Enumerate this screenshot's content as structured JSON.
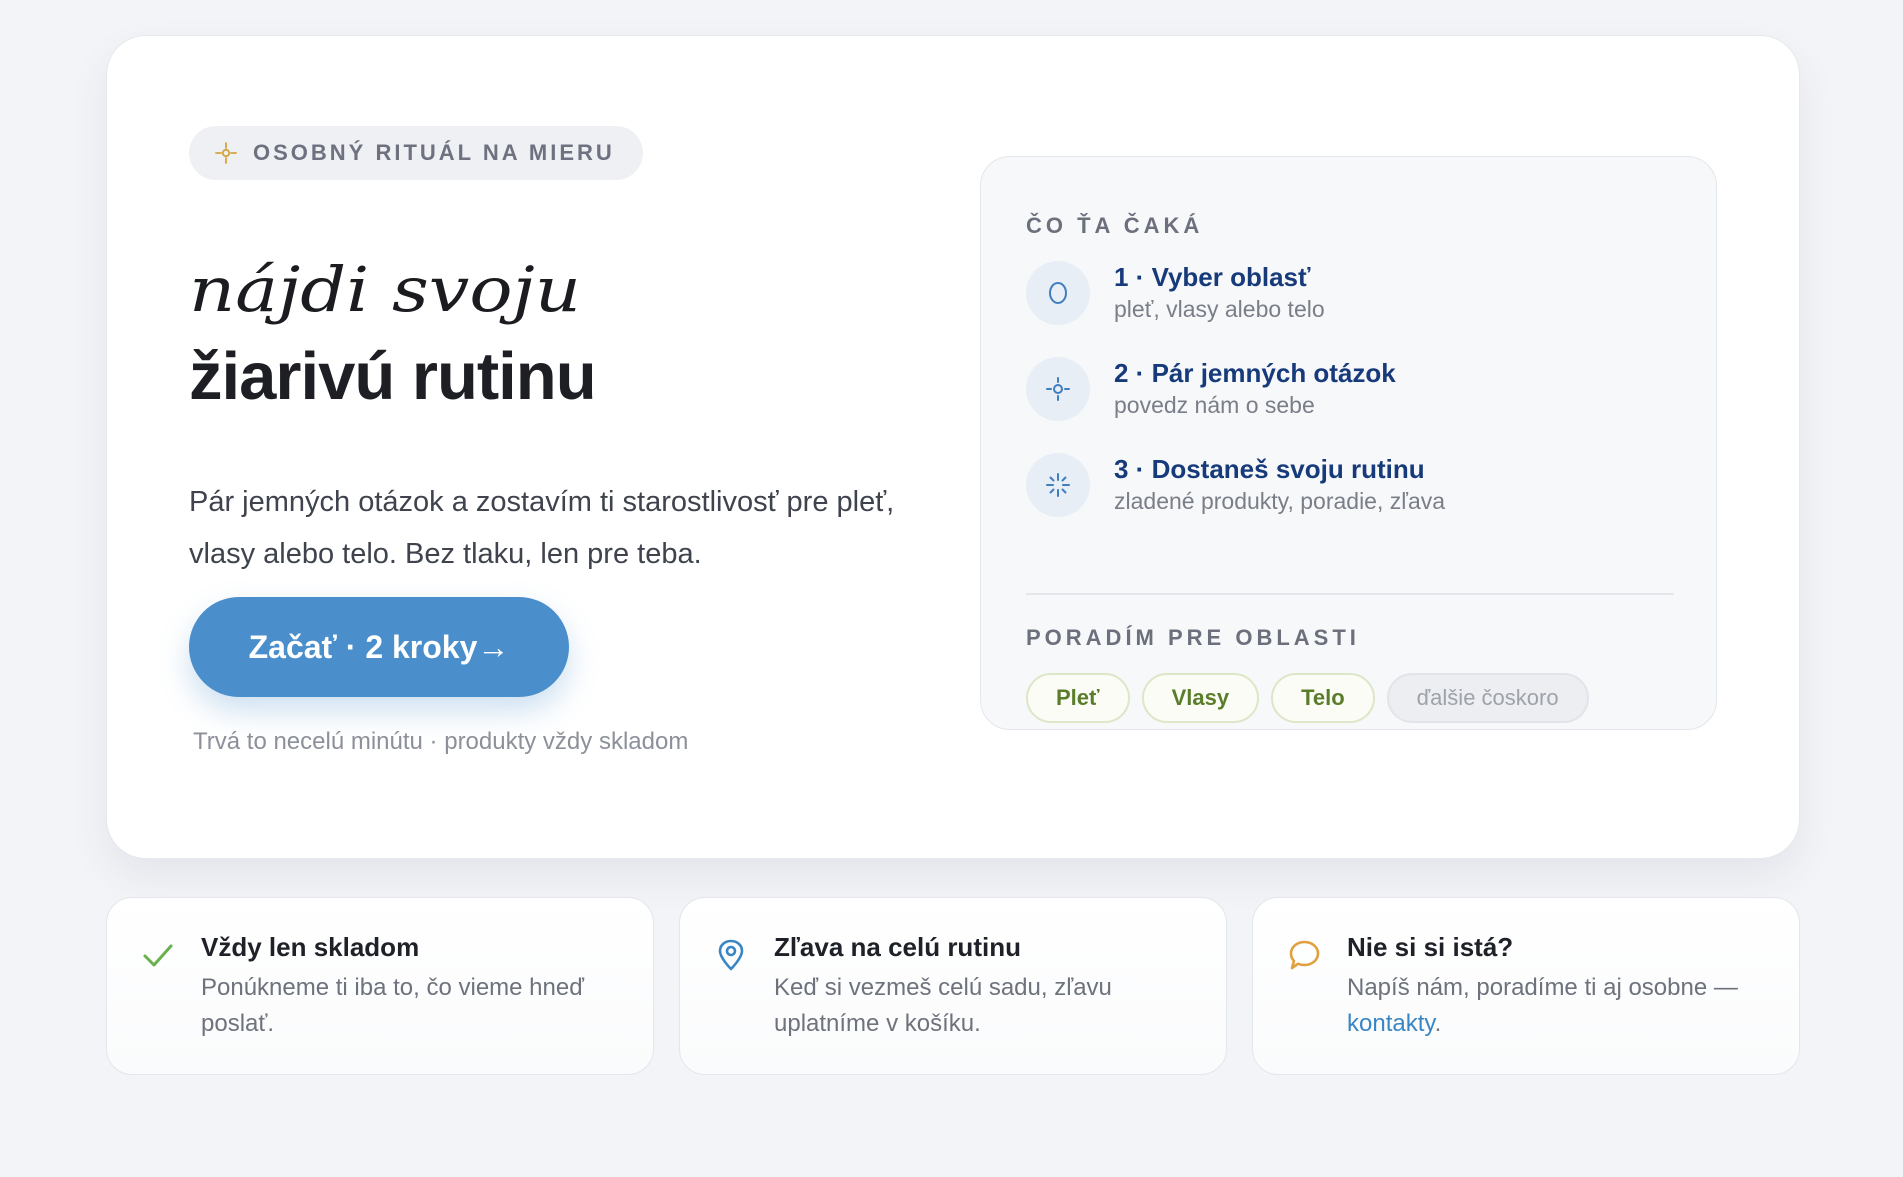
{
  "hero": {
    "badge": {
      "icon": "sparkle-icon",
      "label": "OSOBNÝ RITUÁL NA MIERU"
    },
    "script_heading": "nájdi svoju",
    "headline": "žiarivú rutinu",
    "lead": "Pár jemných otázok a zostavím ti starostlivosť pre pleť, vlasy alebo telo. Bez tlaku, len pre teba.",
    "cta_label": "Začať · 2 kroky→",
    "note": "Trvá to necelú minútu · produkty vždy skladom"
  },
  "steps_card": {
    "heading": "ČO ŤA ČAKÁ",
    "steps": [
      {
        "icon": "drop-icon",
        "title": "1 · Vyber oblasť",
        "subtitle": "pleť, vlasy alebo telo"
      },
      {
        "icon": "target-icon",
        "title": "2 · Pár jemných otázok",
        "subtitle": "povedz nám o sebe"
      },
      {
        "icon": "sparkle-burst-icon",
        "title": "3 · Dostaneš svoju rutinu",
        "subtitle": "zladené produkty, poradie, zľava"
      }
    ],
    "areas_heading": "PORADÍM PRE OBLASTI",
    "areas": [
      "Pleť",
      "Vlasy",
      "Telo"
    ],
    "coming_soon": "ďalšie čoskoro"
  },
  "features": [
    {
      "icon": "check-icon",
      "title": "Vždy len skladom",
      "body": "Ponúkneme ti iba to, čo vieme hneď poslať."
    },
    {
      "icon": "location-pin-icon",
      "title": "Zľava na celú rutinu",
      "body": "Keď si vezmeš celú sadu, zľavu uplatníme v košíku."
    },
    {
      "icon": "chat-bubble-icon",
      "title": "Nie si si istá?",
      "body": "Napíš nám, poradíme ti aj osobne — ",
      "link": "kontakty",
      "suffix": "."
    }
  ],
  "colors": {
    "accent_blue": "#4a8ecb",
    "navy": "#173a7a",
    "chip_green": "#5a7d2a",
    "sparkle_gold": "#d4a43c",
    "check_green": "#6ab04c",
    "chat_orange": "#e0a040",
    "link_blue": "#3a86c4"
  }
}
